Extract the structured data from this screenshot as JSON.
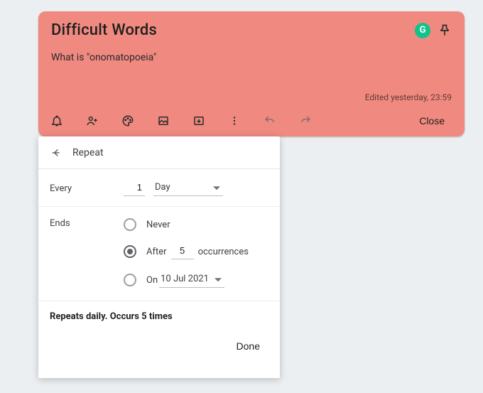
{
  "note": {
    "title": "Difficult Words",
    "body": "What is \"onomatopoeia\"",
    "edited_label": "Edited yesterday, 23:59"
  },
  "toolbar": {
    "close_label": "Close"
  },
  "repeat": {
    "title": "Repeat",
    "every_label": "Every",
    "every_value": "1",
    "unit_label": "Day",
    "ends_label": "Ends",
    "never_label": "Never",
    "after_label": "After",
    "after_value": "5",
    "occurrences_label": "occurrences",
    "on_label": "On",
    "on_date_label": "10 Jul 2021",
    "selected_end": "after",
    "summary": "Repeats daily. Occurs 5 times",
    "done_label": "Done"
  },
  "icons": {
    "grammarly": "G"
  }
}
